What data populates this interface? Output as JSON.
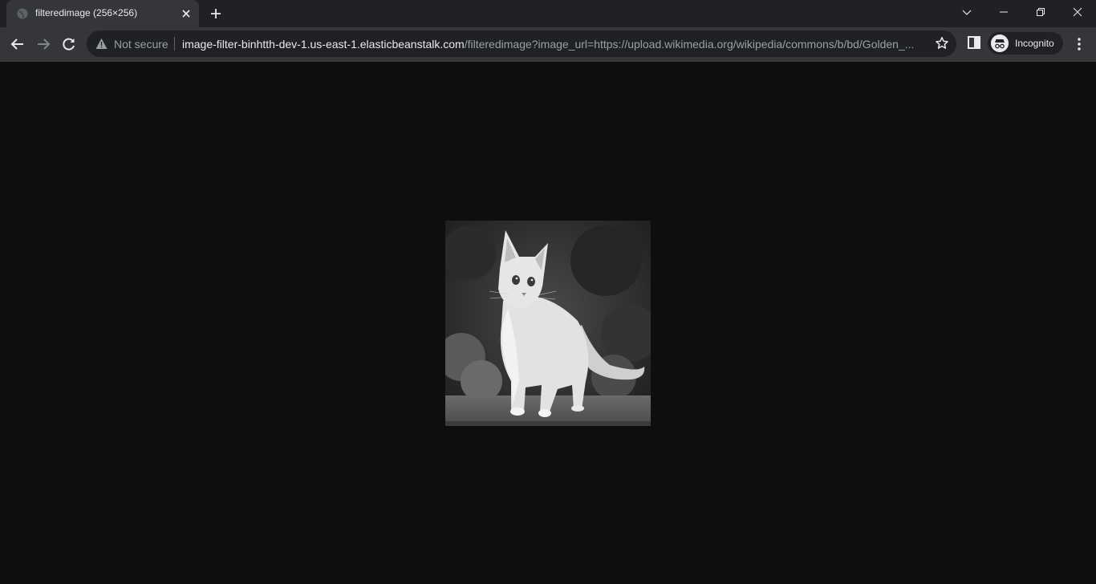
{
  "tab": {
    "title": "filteredimage (256×256)",
    "favicon": "globe-icon"
  },
  "address_bar": {
    "security_label": "Not secure",
    "url_host": "image-filter-binhtth-dev-1.us-east-1.elasticbeanstalk.com",
    "url_path": "/filteredimage?image_url=https://upload.wikimedia.org/wikipedia/commons/b/bd/Golden_..."
  },
  "profile": {
    "label": "Incognito"
  },
  "image": {
    "alt": "grayscale kitten",
    "filter": "grayscale"
  },
  "colors": {
    "tabstrip": "#202124",
    "toolbar": "#35363a",
    "page_background": "#0e0e0e"
  }
}
